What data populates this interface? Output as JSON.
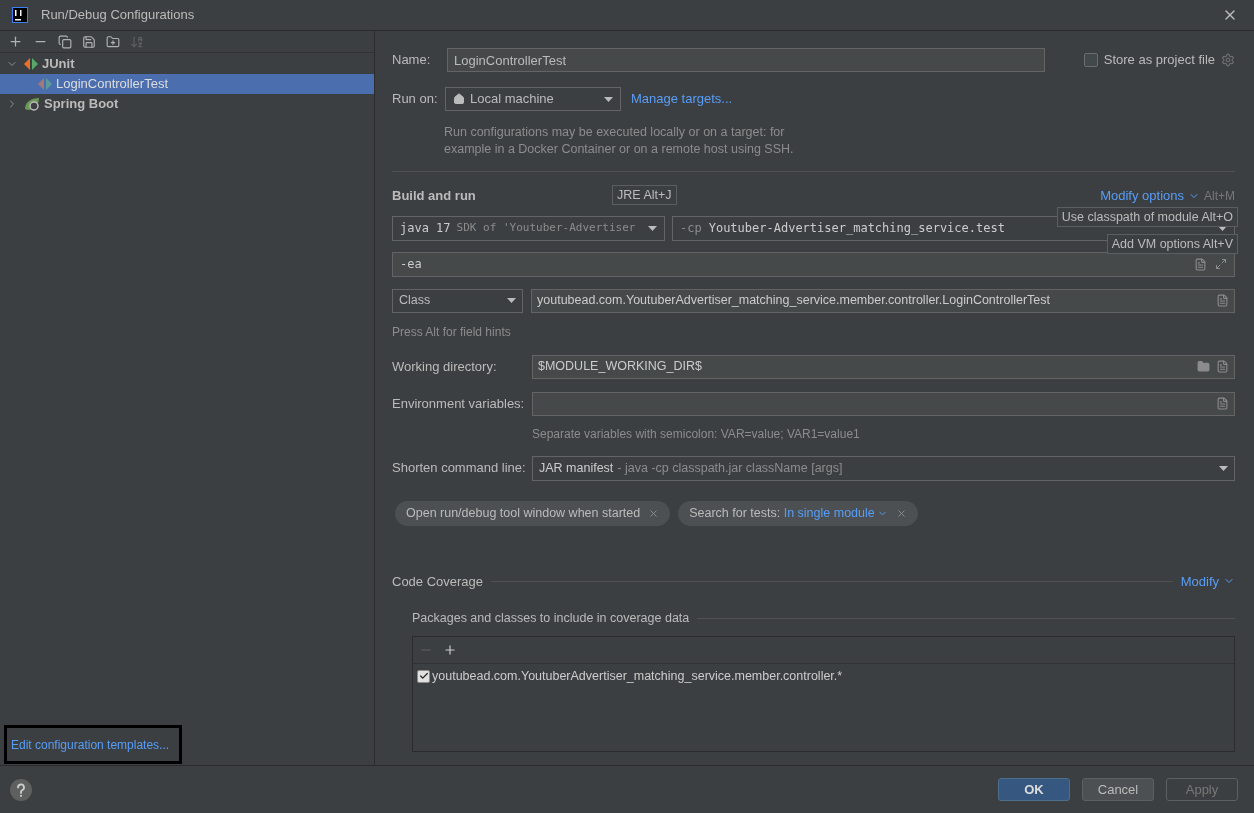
{
  "window": {
    "title": "Run/Debug Configurations"
  },
  "tree": [
    {
      "label": "JUnit",
      "kind": "junit",
      "expanded": true,
      "selected": false,
      "children": [
        {
          "label": "LoginControllerTest",
          "kind": "test",
          "selected": true
        }
      ]
    },
    {
      "label": "Spring Boot",
      "kind": "spring",
      "expanded": false,
      "selected": false
    }
  ],
  "templates_link": "Edit configuration templates...",
  "name": {
    "label": "Name:",
    "value": "LoginControllerTest"
  },
  "store_as_project_file": {
    "label": "Store as project file",
    "checked": false
  },
  "run_on": {
    "label": "Run on:",
    "value": "Local machine",
    "link": "Manage targets...",
    "description": "Run configurations may be executed locally or on a target: for\nexample in a Docker Container or on a remote host using SSH."
  },
  "build_and_run": {
    "title": "Build and run",
    "modify_options": "Modify options",
    "modify_shortcut": "Alt+M",
    "jre": {
      "version": "java 17",
      "detail": "SDK of 'Youtuber-Advertiser"
    },
    "classpath": {
      "prefix": "-cp",
      "value": "Youtuber-Advertiser_matching_service.test"
    },
    "vm_options": "-ea",
    "test_kind": "Class",
    "test_class": "youtubead.com.YoutuberAdvertiser_matching_service.member.controller.LoginControllerTest",
    "hint": "Press Alt for field hints"
  },
  "tooltips": [
    {
      "text": "JRE Alt+J"
    },
    {
      "text": "Use classpath of module Alt+O"
    },
    {
      "text": "Add VM options Alt+V"
    }
  ],
  "working_directory": {
    "label": "Working directory:",
    "value": "$MODULE_WORKING_DIR$"
  },
  "environment_variables": {
    "label": "Environment variables:",
    "hint": "Separate variables with semicolon: VAR=value; VAR1=value1"
  },
  "shorten_command_line": {
    "label": "Shorten command line:",
    "value": "JAR manifest",
    "detail": "- java -cp classpath.jar className [args]"
  },
  "chips": [
    {
      "label": "Open run/debug tool window when started"
    },
    {
      "label": "Search for tests:",
      "value": "In single module"
    }
  ],
  "code_coverage": {
    "title": "Code Coverage",
    "modify": "Modify",
    "packages_title": "Packages and classes to include in coverage data",
    "patterns": [
      {
        "text": "youtubead.com.YoutuberAdvertiser_matching_service.member.controller.*",
        "checked": true
      }
    ]
  },
  "buttons": [
    {
      "label": "OK",
      "kind": "primary",
      "disabled": false
    },
    {
      "label": "Cancel",
      "kind": "normal",
      "disabled": false
    },
    {
      "label": "Apply",
      "kind": "normal",
      "disabled": true
    }
  ]
}
